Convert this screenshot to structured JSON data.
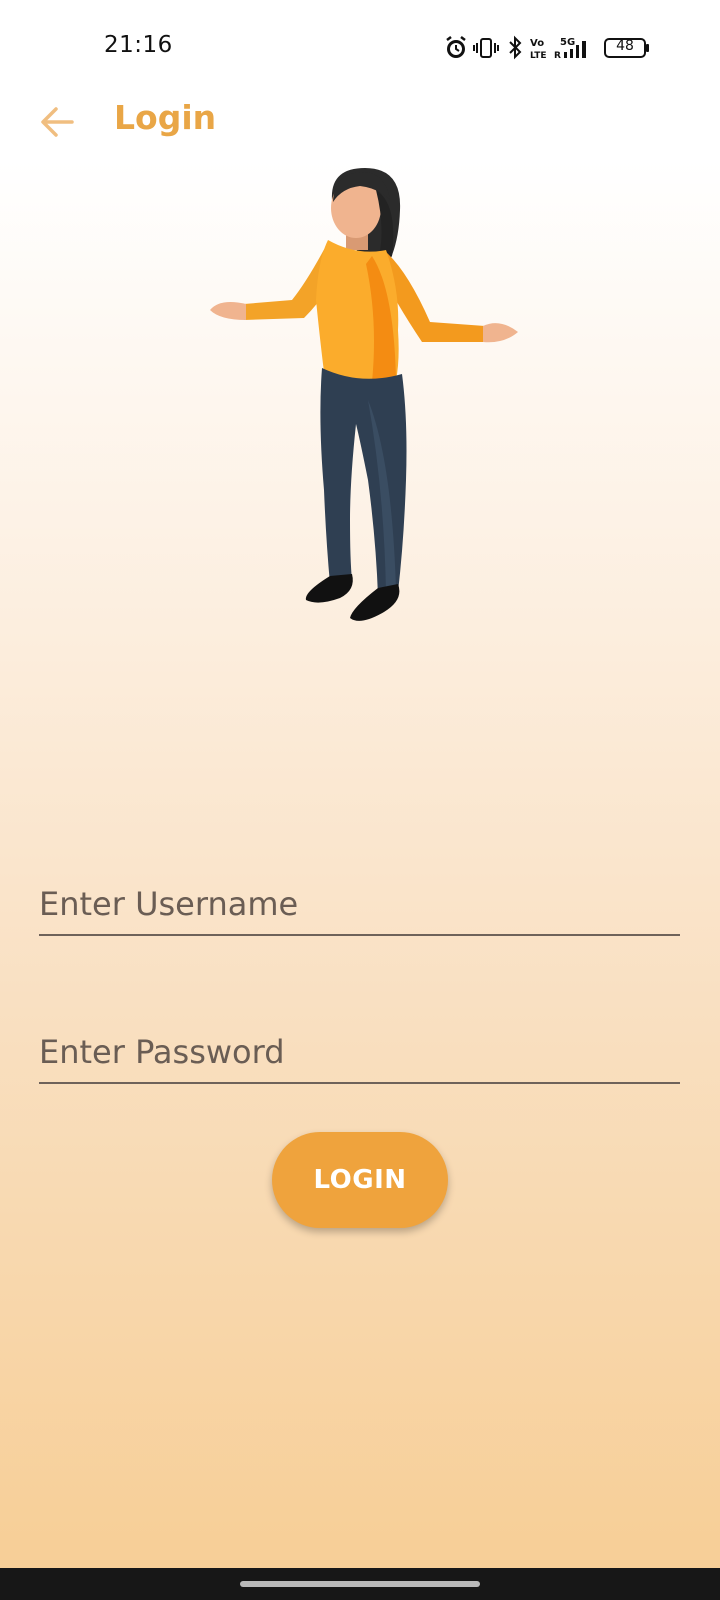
{
  "status_bar": {
    "time": "21:16",
    "icons": [
      "alarm-icon",
      "vibrate-icon",
      "bluetooth-icon",
      "volte-icon",
      "5g-signal-icon",
      "battery-icon"
    ],
    "volte_label": "Vo\nLTE",
    "network_label": "5G",
    "battery_level": "48"
  },
  "app_bar": {
    "back_icon": "arrow-left-icon",
    "title": "Login"
  },
  "form": {
    "username_placeholder": "Enter Username",
    "username_value": "",
    "password_placeholder": "Enter Password",
    "password_value": "",
    "login_label": "LOGIN"
  },
  "colors": {
    "accent": "#e9a646",
    "button": "#efa33d",
    "background_top": "#ffffff",
    "background_bottom": "#f7cf98",
    "nav_bar": "#171717"
  }
}
